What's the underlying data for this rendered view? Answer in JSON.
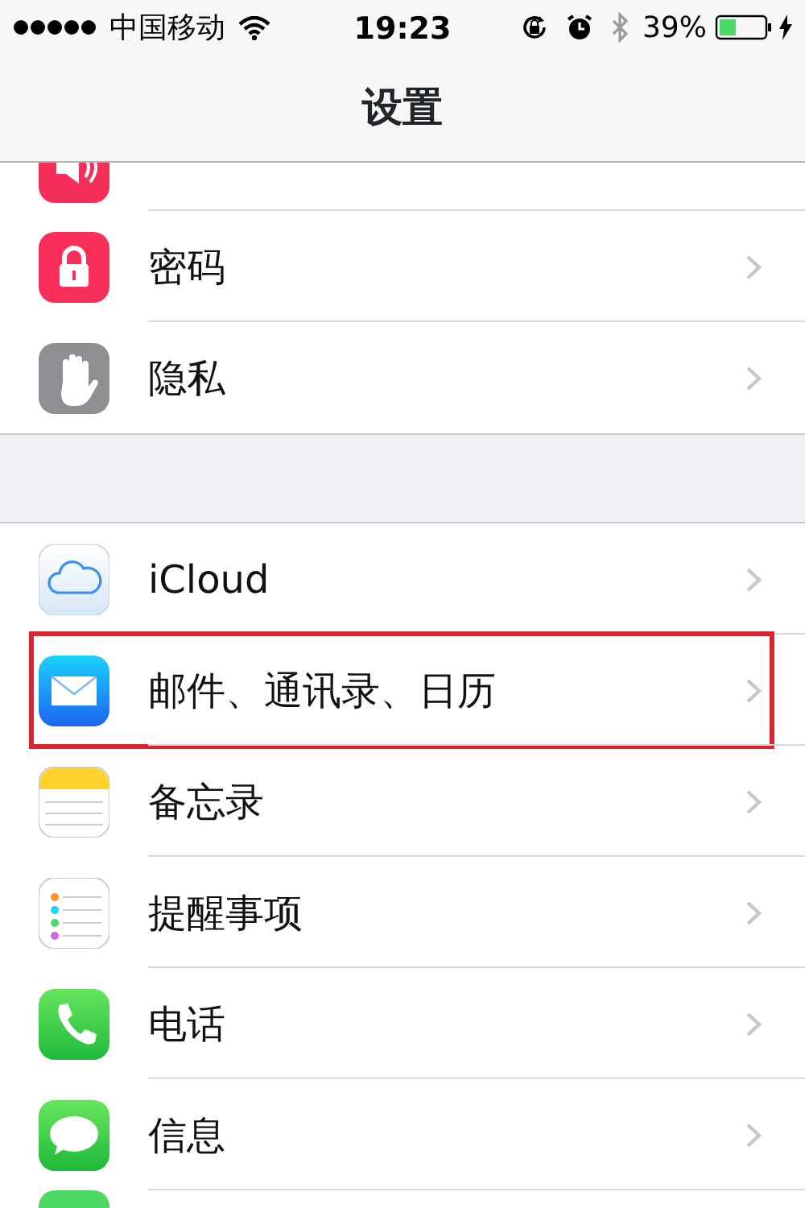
{
  "status_bar": {
    "carrier": "中国移动",
    "time": "19:23",
    "battery": "39%"
  },
  "nav_bar": {
    "title": "设置"
  },
  "sections": [
    {
      "rows": [
        {
          "kind": "sound"
        },
        {
          "kind": "lock",
          "label": "密码",
          "annotated": false
        },
        {
          "kind": "hand",
          "label": "隐私",
          "annotated": false
        }
      ]
    },
    {
      "rows": [
        {
          "kind": "cloud",
          "label": "iCloud",
          "annotated": false
        },
        {
          "kind": "mail",
          "label": "邮件、通讯录、日历",
          "annotated": true
        },
        {
          "kind": "notes",
          "label": "备忘录",
          "annotated": false
        },
        {
          "kind": "reminders",
          "label": "提醒事项",
          "annotated": false
        },
        {
          "kind": "phone",
          "label": "电话",
          "annotated": false
        },
        {
          "kind": "message",
          "label": "信息",
          "annotated": false
        },
        {
          "kind": "video"
        }
      ]
    }
  ]
}
